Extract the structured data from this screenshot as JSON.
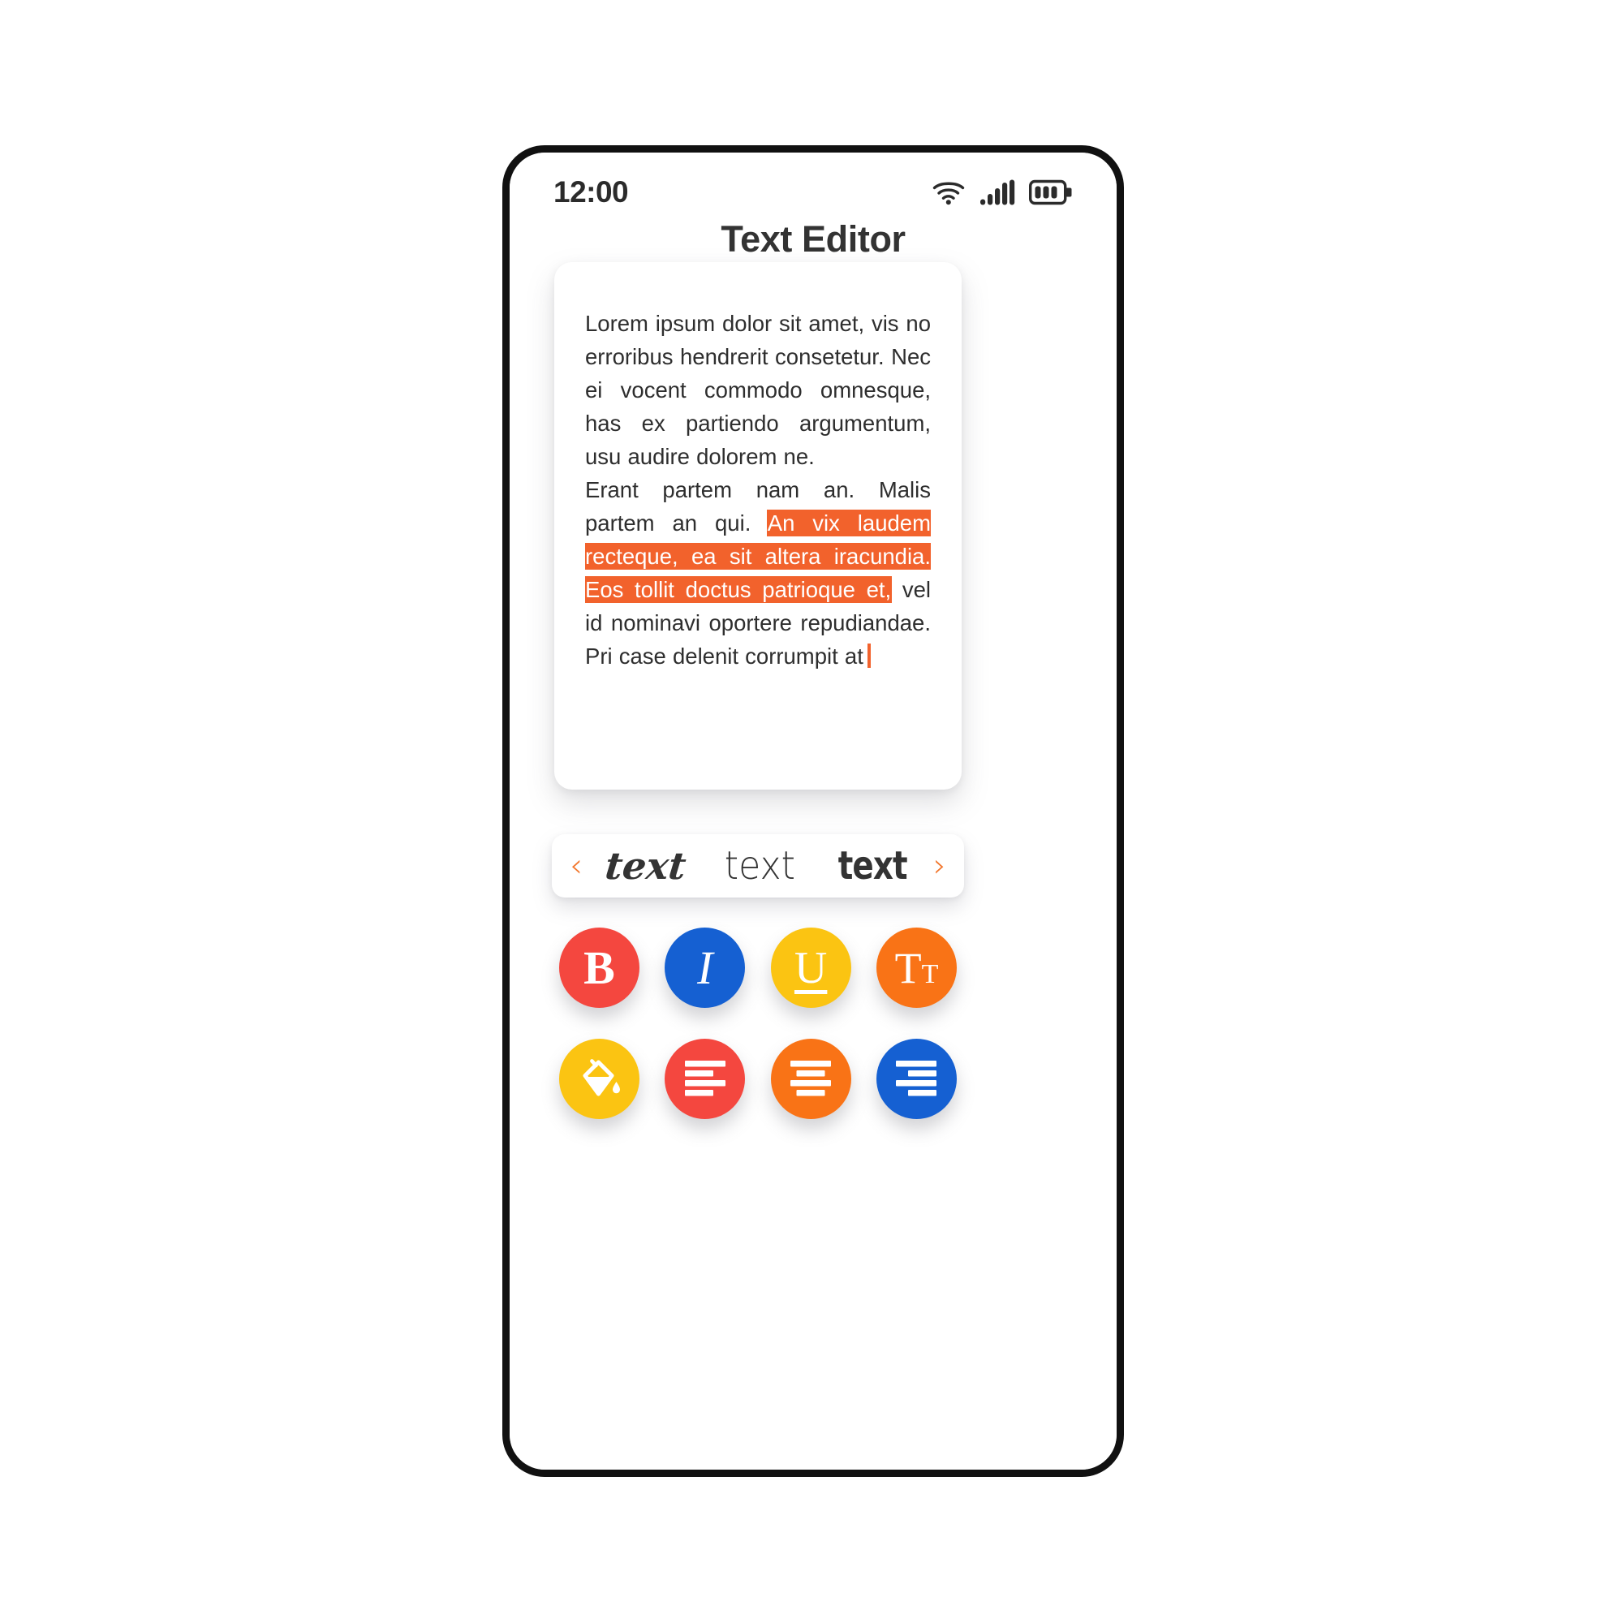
{
  "app": {
    "title": "Text Editor"
  },
  "status_bar": {
    "time": "12:00",
    "wifi_icon": "wifi-icon",
    "signal_icon": "cellular-signal-icon",
    "battery_icon": "battery-icon"
  },
  "editor": {
    "paragraph_1": "Lorem ipsum dolor sit amet, vis no erroribus hendrerit consetetur. Nec ei vocent commodo omnesque, has ex partiendo argumentum, usu audire dolorem ne.",
    "paragraph_2_pre": "Erant partem nam an. Malis partem an qui. ",
    "paragraph_2_highlighted": "An vix laudem recteque, ea sit altera iracundia. Eos tollit doctus patrioque et,",
    "paragraph_2_post": " vel id nominavi oportere repudiandae. Pri case delenit corrumpit at",
    "highlight_color": "#f2622c",
    "caret_color": "#f2622c"
  },
  "font_selector": {
    "prev_label": "‹",
    "next_label": "›",
    "chevron_color": "#f2762c",
    "samples": [
      {
        "label": "text",
        "style": "italic-serif"
      },
      {
        "label": "text",
        "style": "thin-sans"
      },
      {
        "label": "text",
        "style": "bold-condensed"
      }
    ]
  },
  "tools": {
    "row_1": [
      {
        "name": "bold-button",
        "label": "B",
        "color": "#f4473f"
      },
      {
        "name": "italic-button",
        "label": "I",
        "color": "#1560d2"
      },
      {
        "name": "underline-button",
        "label": "U",
        "color": "#fbc412"
      },
      {
        "name": "font-size-button",
        "label": "T",
        "sub_label": "T",
        "color": "#f97316"
      }
    ],
    "row_2": [
      {
        "name": "fill-color-button",
        "icon": "paint-bucket-icon",
        "color": "#fbc412"
      },
      {
        "name": "align-left-button",
        "icon": "align-left-icon",
        "color": "#f4473f"
      },
      {
        "name": "align-center-button",
        "icon": "align-center-icon",
        "color": "#f97316"
      },
      {
        "name": "align-right-button",
        "icon": "align-right-icon",
        "color": "#1560d2"
      }
    ]
  }
}
